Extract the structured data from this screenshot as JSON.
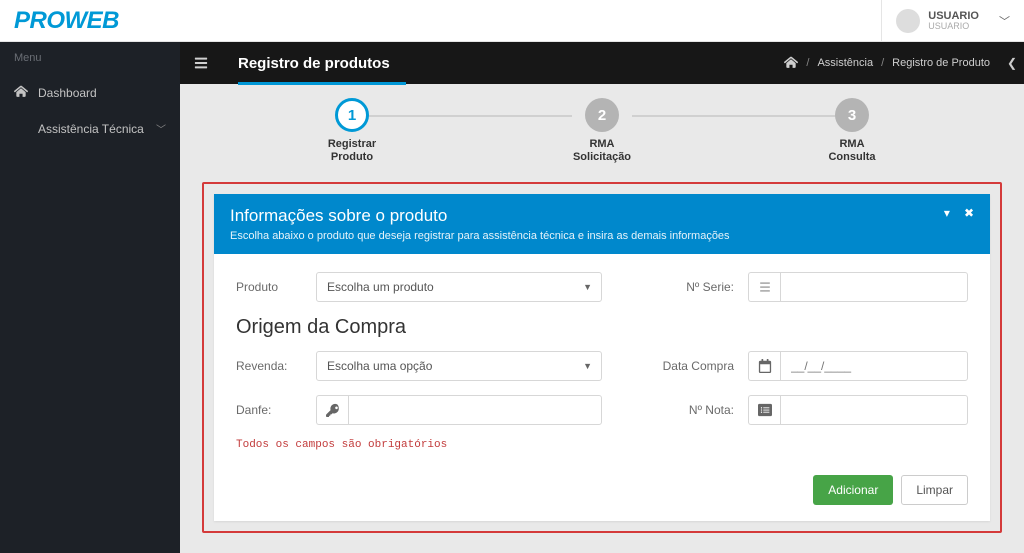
{
  "brand": "PROWEB",
  "user": {
    "name": "USUARIO",
    "sub": "USUARIO"
  },
  "sidebar": {
    "header": "Menu",
    "items": [
      {
        "label": "Dashboard"
      },
      {
        "label": "Assistência Técnica"
      }
    ]
  },
  "page": {
    "title": "Registro de produtos",
    "breadcrumb": {
      "home_icon": "home",
      "level1": "Assistência",
      "level2": "Registro de Produto"
    }
  },
  "stepper": {
    "steps": [
      {
        "num": "1",
        "line1": "Registrar",
        "line2": "Produto"
      },
      {
        "num": "2",
        "line1": "RMA",
        "line2": "Solicitação"
      },
      {
        "num": "3",
        "line1": "RMA",
        "line2": "Consulta"
      }
    ]
  },
  "panel": {
    "title": "Informações sobre o produto",
    "subtitle": "Escolha abaixo o produto que deseja registrar para assistência técnica e insira as demais informações",
    "fields": {
      "produto_label": "Produto",
      "produto_placeholder": "Escolha um produto",
      "nserie_label": "Nº Serie:",
      "origem_title": "Origem da Compra",
      "revenda_label": "Revenda:",
      "revenda_placeholder": "Escolha uma opção",
      "datacompra_label": "Data Compra",
      "datacompra_placeholder": "__/__/____",
      "danfe_label": "Danfe:",
      "nnota_label": "Nº Nota:"
    },
    "required_msg": "Todos os campos são obrigatórios",
    "buttons": {
      "add": "Adicionar",
      "clear": "Limpar"
    }
  }
}
